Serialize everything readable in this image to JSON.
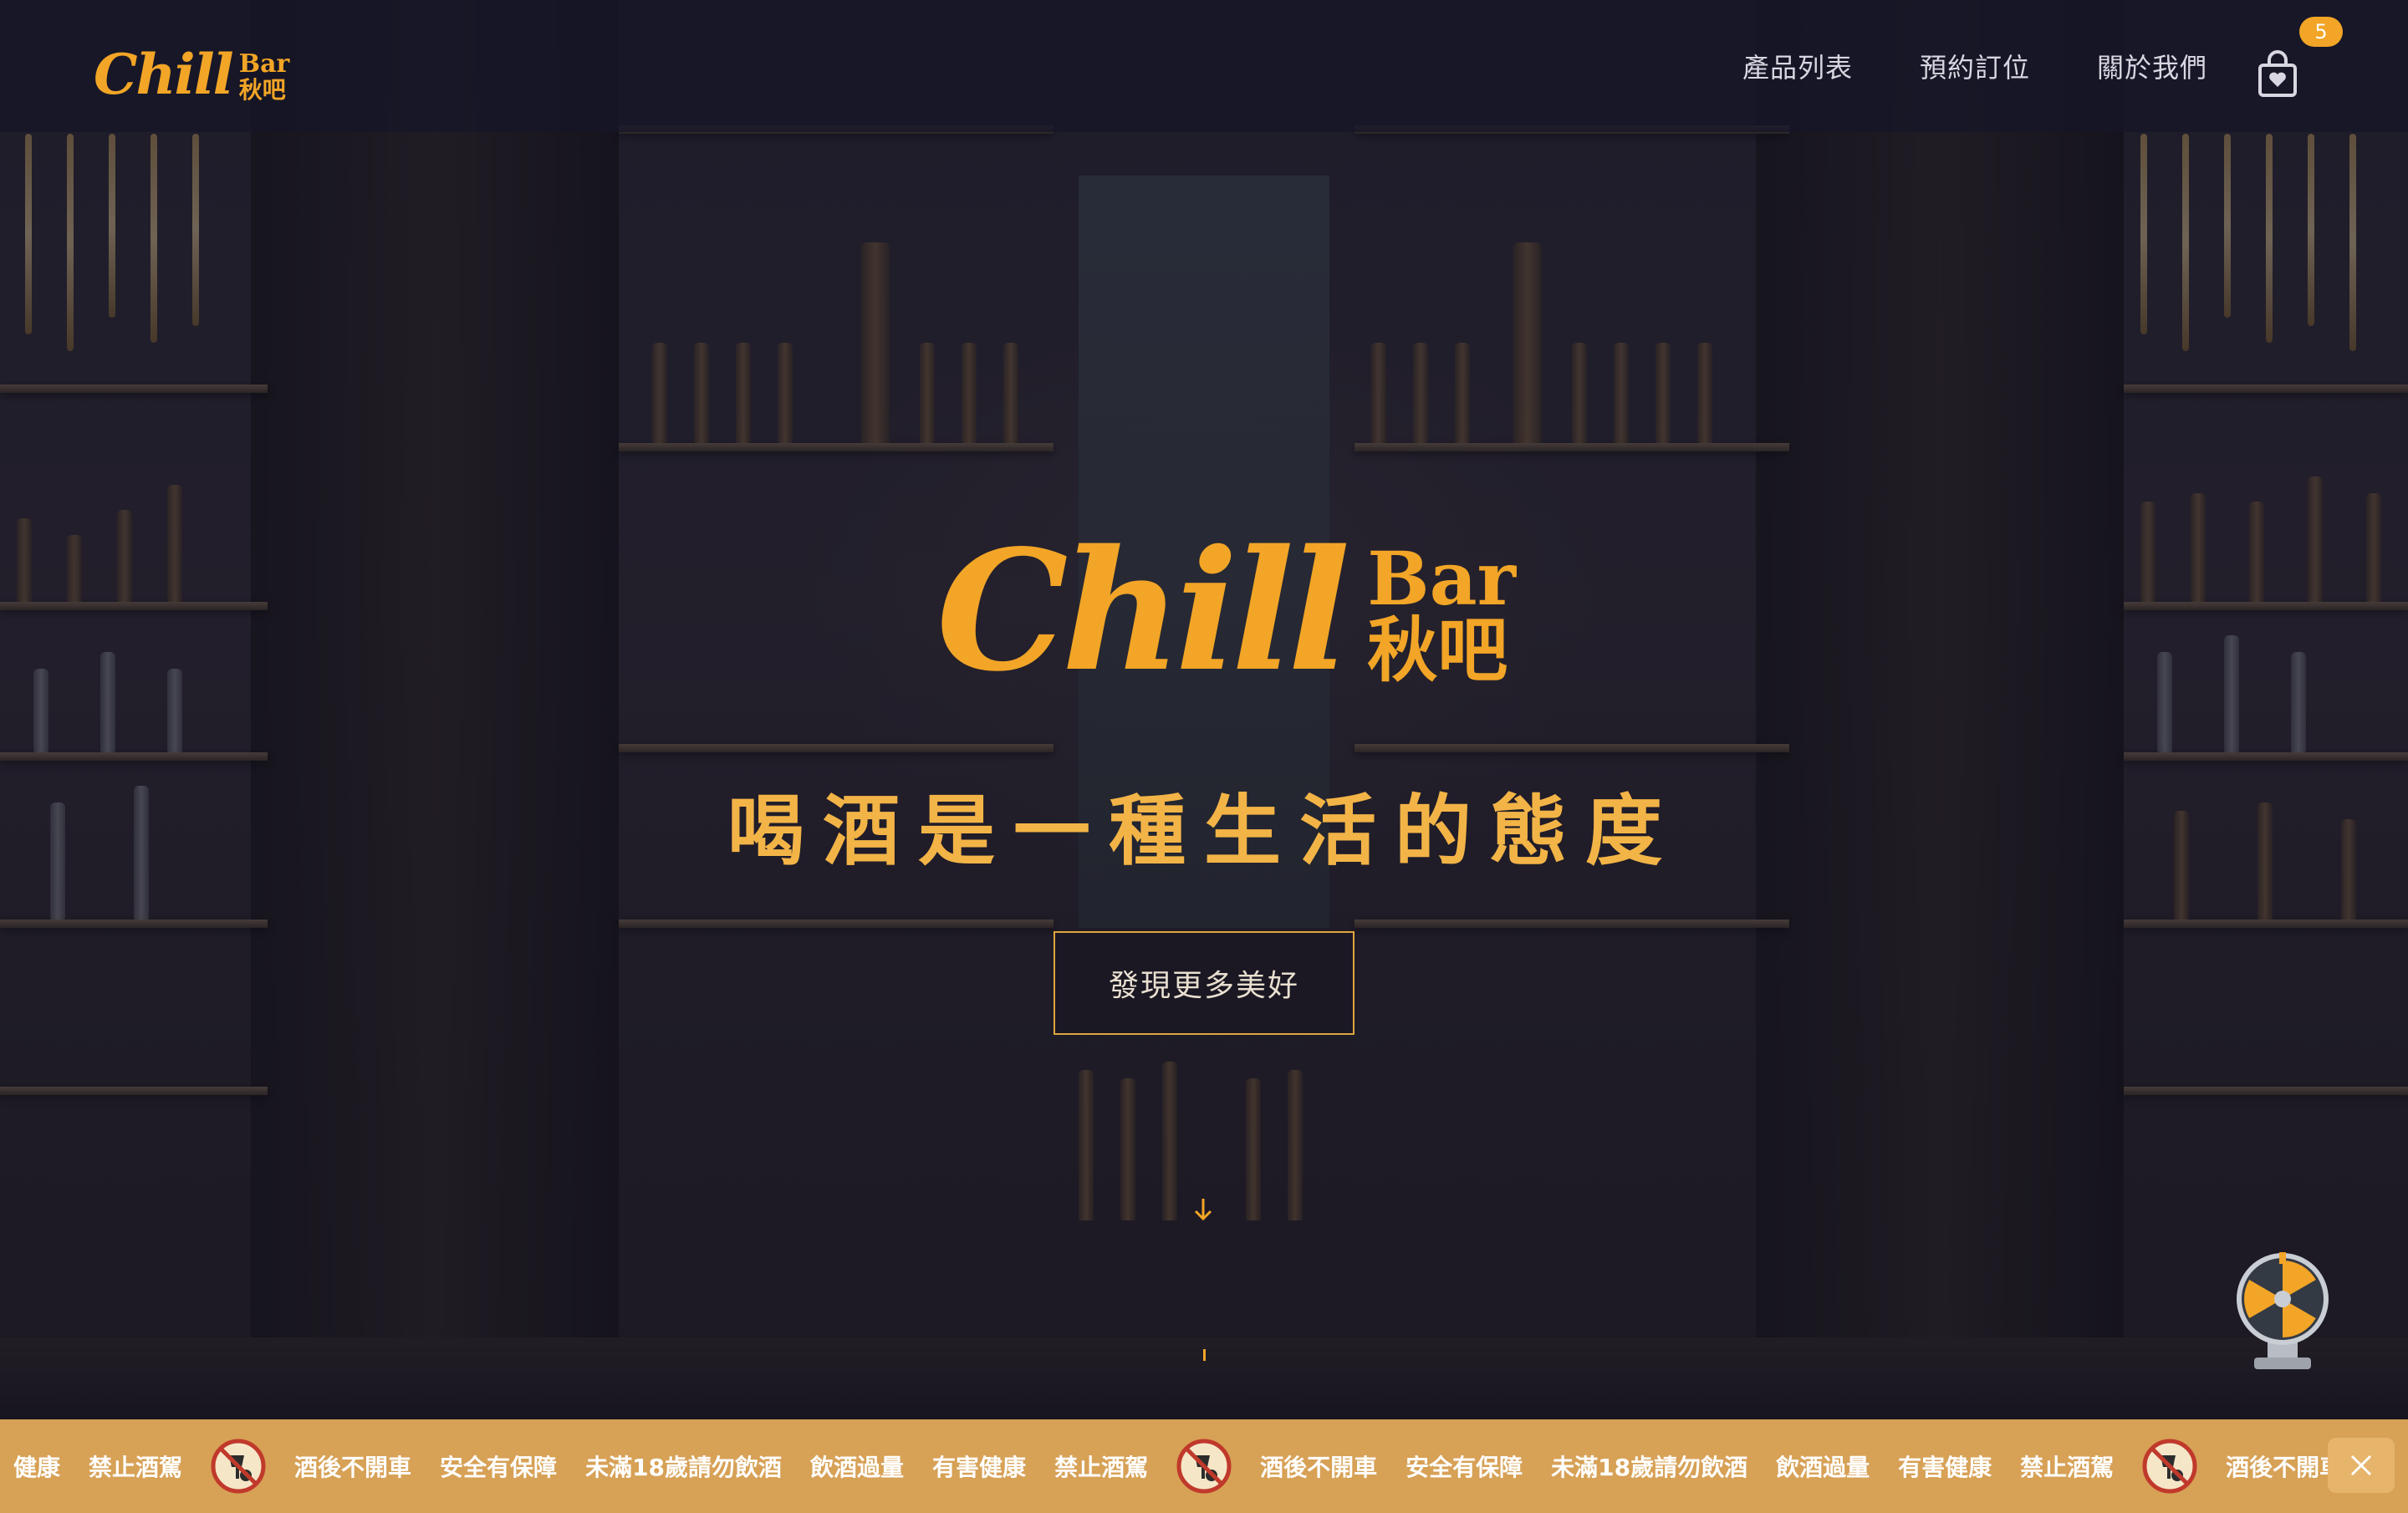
{
  "brand": {
    "logo_script": "Chill",
    "logo_bar": "Bar",
    "logo_cn": "秋吧"
  },
  "nav": {
    "items": [
      {
        "label": "產品列表"
      },
      {
        "label": "預約訂位"
      },
      {
        "label": "關於我們"
      }
    ],
    "cart_count": "5",
    "cart_icon": "shopping-bag-heart-icon"
  },
  "hero": {
    "logo_script": "Chill",
    "logo_bar": "Bar",
    "logo_cn": "秋吧",
    "tagline": "喝酒是一種生活的態度",
    "cta_label": "發現更多美好",
    "scroll_icon": "arrow-down-icon"
  },
  "widget": {
    "icon": "lucky-wheel-icon"
  },
  "ticker": {
    "items": [
      "健康",
      "禁止酒駕",
      "酒後不開車",
      "安全有保障",
      "未滿18歲請勿飲酒",
      "飲酒過量",
      "有害健康",
      "禁止酒駕",
      "酒後不開車",
      "安全有保障",
      "未滿18歲請勿飲酒",
      "飲酒過量",
      "有害健康",
      "禁止酒駕",
      "酒後不開車"
    ],
    "icon": "no-drinking-driving-icon",
    "close_icon": "close-icon"
  },
  "colors": {
    "accent": "#f2a526",
    "ticker_bg": "#d7a156",
    "header_bg": "#16162a"
  }
}
